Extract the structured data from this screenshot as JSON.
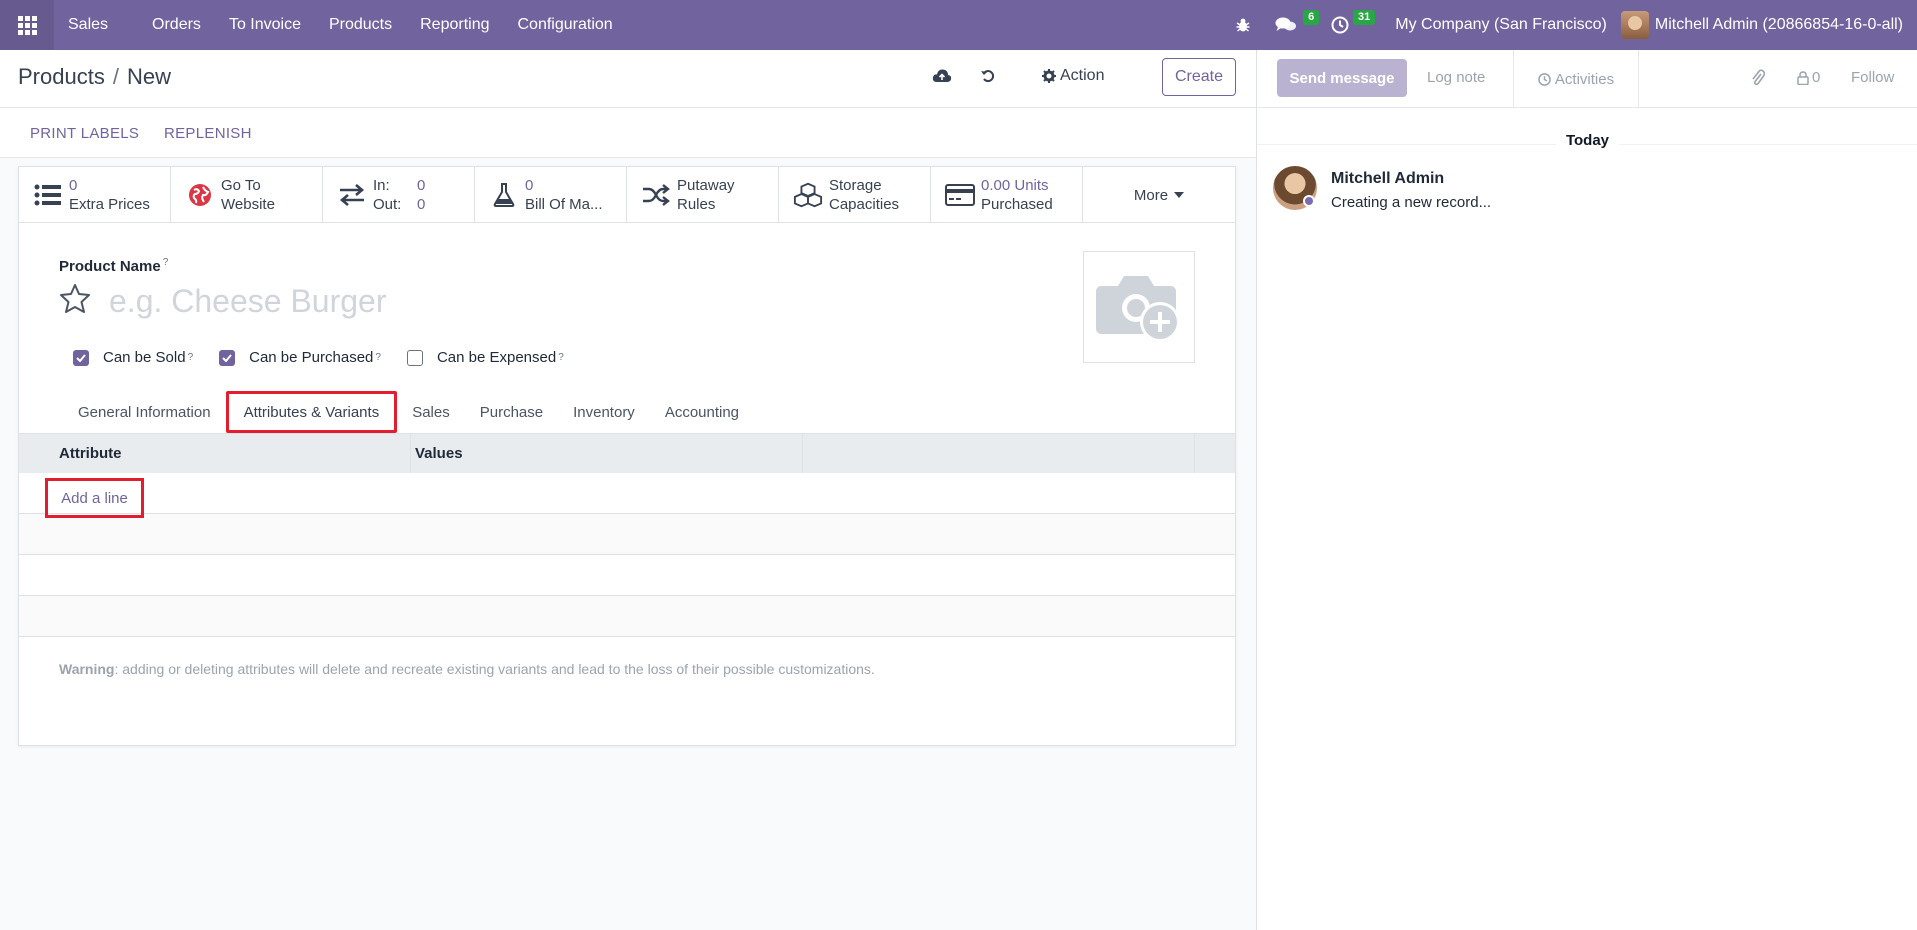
{
  "navbar": {
    "app_name": "Sales",
    "menu": [
      "Orders",
      "To Invoice",
      "Products",
      "Reporting",
      "Configuration"
    ],
    "messages_count": "6",
    "activities_count": "31",
    "company": "My Company (San Francisco)",
    "user": "Mitchell Admin (20866854-16-0-all)",
    "icons": [
      "apps-grid-icon",
      "bug-icon",
      "chat-icon",
      "clock-icon"
    ]
  },
  "control": {
    "breadcrumb_parent": "Products",
    "breadcrumb_sep": "/",
    "breadcrumb_current": "New",
    "action_label": "Action",
    "create_label": "Create"
  },
  "statusbar": {
    "print_labels": "PRINT LABELS",
    "replenish": "REPLENISH"
  },
  "smart_buttons": {
    "extra_prices_value": "0",
    "extra_prices_label": "Extra Prices",
    "website_line1": "Go To",
    "website_line2": "Website",
    "in_label": "In:",
    "in_value": "0",
    "out_label": "Out:",
    "out_value": "0",
    "bom_value": "0",
    "bom_label": "Bill Of Ma...",
    "putaway_line1": "Putaway",
    "putaway_line2": "Rules",
    "storage_line1": "Storage",
    "storage_line2": "Capacities",
    "purchased_value": "0.00 Units",
    "purchased_label": "Purchased",
    "more_label": "More"
  },
  "form": {
    "product_name_label": "Product Name",
    "help_mark": "?",
    "product_name_placeholder": "e.g. Cheese Burger",
    "can_be_sold": "Can be Sold",
    "can_be_purchased": "Can be Purchased",
    "can_be_expensed": "Can be Expensed",
    "can_be_sold_checked": true,
    "can_be_purchased_checked": true,
    "can_be_expensed_checked": false
  },
  "tabs": [
    "General Information",
    "Attributes & Variants",
    "Sales",
    "Purchase",
    "Inventory",
    "Accounting"
  ],
  "active_tab": "Attributes & Variants",
  "table": {
    "col_attribute": "Attribute",
    "col_values": "Values",
    "add_line": "Add a line"
  },
  "warning": {
    "prefix": "Warning",
    "text": ": adding or deleting attributes will delete and recreate existing variants and lead to the loss of their possible customizations."
  },
  "chatter": {
    "send_message": "Send message",
    "log_note": "Log note",
    "activities": "Activities",
    "followers_count": "0",
    "follow": "Follow",
    "today": "Today",
    "message_author": "Mitchell Admin",
    "message_body": "Creating a new record..."
  },
  "colors": {
    "brand": "#71639e",
    "highlight": "#e11d2e",
    "badge": "#28a745"
  }
}
